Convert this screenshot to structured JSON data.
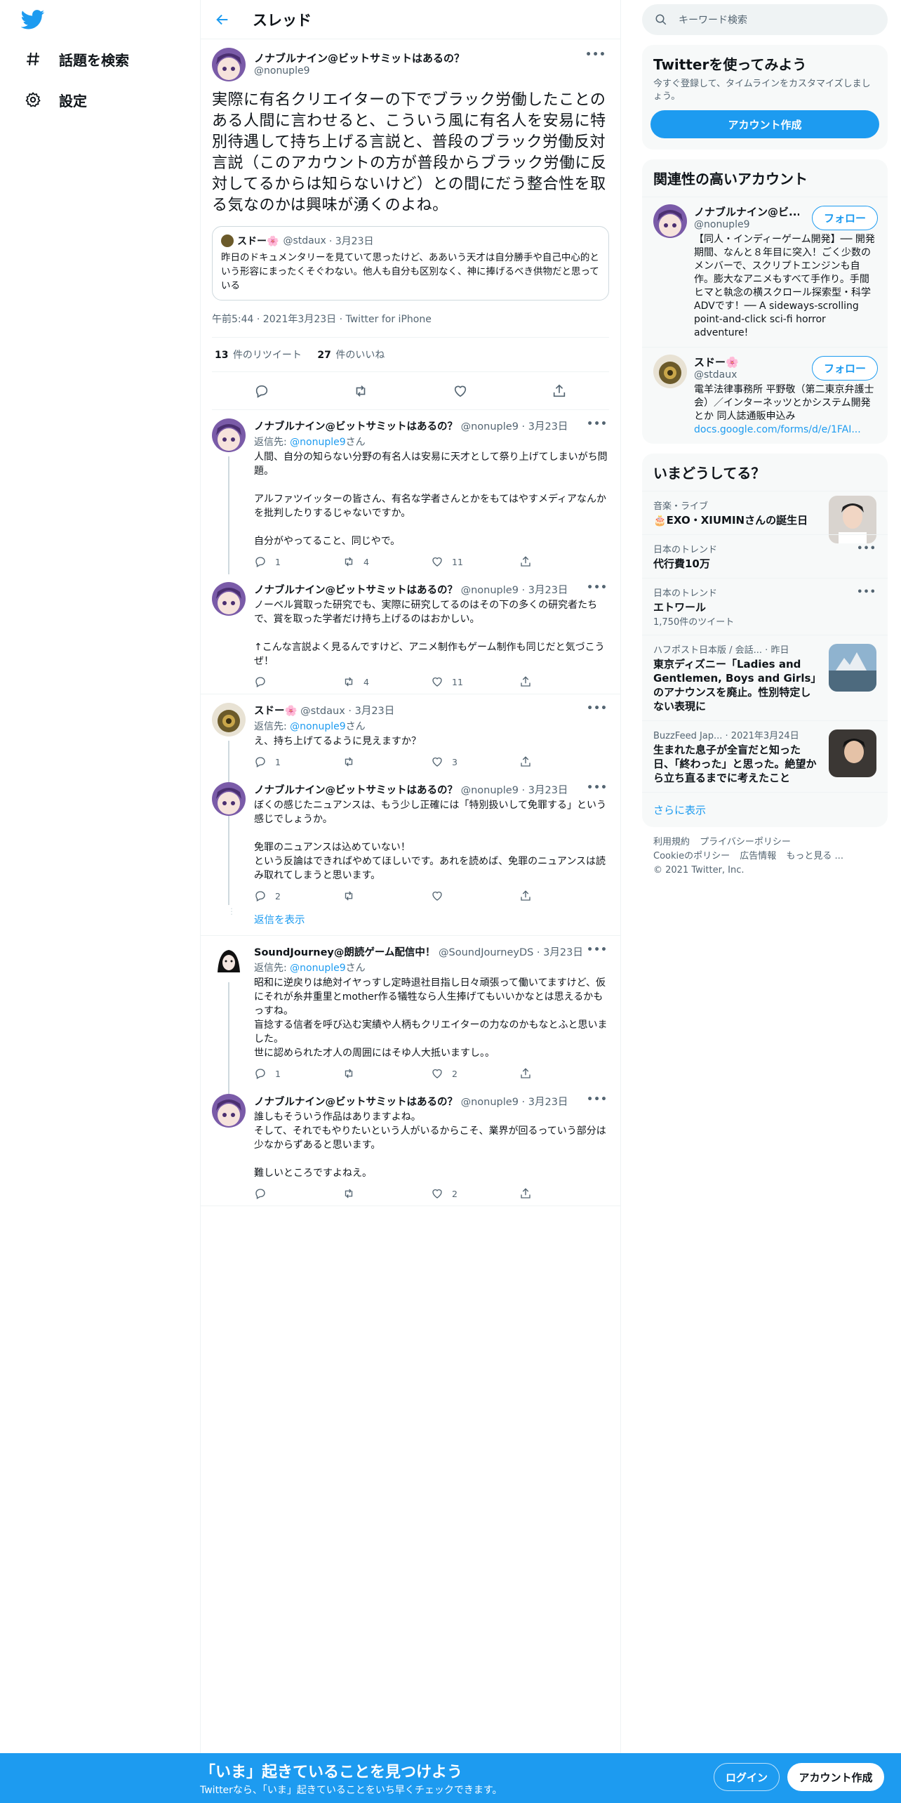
{
  "nav": {
    "explore_label": "話題を検索",
    "settings_label": "設定"
  },
  "header": {
    "title": "スレッド"
  },
  "main_tweet": {
    "name": "ノナブルナイン@ビットサミットはあるの？",
    "handle": "@nonuple9",
    "text": "実際に有名クリエイターの下でブラック労働したことのある人間に言わせると、こういう風に有名人を安易に特別待遇して持ち上げる言説と、普段のブラック労働反対言説（このアカウントの方が普段からブラック労働に反対してるからは知らないけど）との間にだう整合性を取る気なのかは興味が湧くのよね。",
    "quote": {
      "name": "スドー🌸",
      "handle": "@stdaux",
      "date": "· 3月23日",
      "text": "昨日のドキュメンタリーを見ていて思ったけど、ああいう天才は自分勝手や自己中心的という形容にまったくそぐわない。他人も自分も区別なく、神に捧げるべき供物だと思っている"
    },
    "meta": "午前5:44 · 2021年3月23日 · Twitter for iPhone",
    "retweets": "13",
    "retweets_label": "件のリツイート",
    "likes": "27",
    "likes_label": "件のいいね"
  },
  "replies": [
    {
      "name": "ノナブルナイン@ビットサミットはあるの？",
      "handle": "@nonuple9 · 3月23日",
      "replyto_prefix": "返信先: ",
      "replyto": "@nonuple9",
      "replyto_suffix": "さん",
      "text": "人間、自分の知らない分野の有名人は安易に天才として祭り上げてしまいがち問題。\n\nアルファツイッターの皆さん、有名な学者さんとかをもてはやすメディアなんかを批判したりするじゃないですか。\n\n自分がやってること、同じやで。",
      "reply_count": "1",
      "retweet_count": "4",
      "like_count": "11"
    },
    {
      "name": "ノナブルナイン@ビットサミットはあるの？",
      "handle": "@nonuple9 · 3月23日",
      "text": "ノーベル賞取った研究でも、実際に研究してるのはその下の多くの研究者たちで、賞を取った学者だけ持ち上げるのはおかしい。\n\n↑こんな言説よく見るんですけど、アニメ制作もゲーム制作も同じだと気づこうぜ！",
      "reply_count": "",
      "retweet_count": "4",
      "like_count": "11"
    },
    {
      "name": "スドー🌸",
      "handle": "@stdaux · 3月23日",
      "replyto_prefix": "返信先: ",
      "replyto": "@nonuple9",
      "replyto_suffix": "さん",
      "text": "え、持ち上げてるように見えますか？",
      "reply_count": "1",
      "retweet_count": "",
      "like_count": "3"
    },
    {
      "name": "ノナブルナイン@ビットサミットはあるの？",
      "handle": "@nonuple9 · 3月23日",
      "text": "ぼくの感じたニュアンスは、もう少し正確には「特別扱いして免罪する」という感じでしょうか。\n\n免罪のニュアンスは込めていない！\nという反論はできればやめてほしいです。あれを読めば、免罪のニュアンスは読み取れてしまうと思います。",
      "reply_count": "2",
      "retweet_count": "",
      "like_count": ""
    },
    {
      "name": "SoundJourney@朗読ゲーム配信中！",
      "handle": "@SoundJourneyDS · 3月23日",
      "replyto_prefix": "返信先: ",
      "replyto": "@nonuple9",
      "replyto_suffix": "さん",
      "text": "昭和に逆戻りは絶対イヤっすし定時退社目指し日々頑張って働いてますけど、仮にそれが糸井重里とmother作る犠牲なら人生捧げてもいいかなとは思えるかもっすね。\n盲捻する信者を呼び込む実績や人柄もクリエイターの力なのかもなとふと思いました。\n世に認められた才人の周囲にはそゆ人大抵いますし。。",
      "reply_count": "1",
      "retweet_count": "",
      "like_count": "2"
    },
    {
      "name": "ノナブルナイン@ビットサミットはあるの？",
      "handle": "@nonuple9 · 3月23日",
      "text": "誰しもそういう作品はありますよね。\nそして、それでもやりたいという人がいるからこそ、業界が回るっていう部分は少なからずあると思います。\n\n難しいところですよねえ。",
      "reply_count": "",
      "retweet_count": "",
      "like_count": "2"
    }
  ],
  "show_replies": "返信を表示",
  "sidebar": {
    "search_placeholder": "キーワード検索",
    "signup_title": "Twitterを使ってみよう",
    "signup_sub": "今すぐ登録して、タイムラインをカスタマイズしましょう。",
    "signup_button": "アカウント作成",
    "related_title": "関連性の高いアカウント",
    "follow_label": "フォロー",
    "accounts": [
      {
        "name": "ノナブルナイン@ビ...",
        "handle": "@nonuple9",
        "bio": "【同人・インディーゲーム開発】── 開発期間、なんと８年目に突入！ごく少数のメンバーで、スクリプトエンジンも自作。膨大なアニメもすべて手作り。手間ヒマと執念の横スクロール探索型・科学ADVです！── A sideways-scrolling point-and-click sci-fi horror adventure!",
        "link": ""
      },
      {
        "name": "スドー🌸",
        "handle": "@stdaux",
        "bio": "電羊法律事務所 平野敬（第二東京弁護士会）／インターネッツとかシステム開発とか 同人誌通販申込み ",
        "link": "docs.google.com/forms/d/e/1FAI..."
      }
    ],
    "trends_title": "いまどうしてる？",
    "trends": [
      {
        "context": "音楽・ライブ",
        "title": "🎂EXO・XIUMINさんの誕生日",
        "sub": ""
      },
      {
        "context": "日本のトレンド",
        "title": "代行費10万",
        "sub": ""
      },
      {
        "context": "日本のトレンド",
        "title": "エトワール",
        "sub": "1,750件のツイート"
      },
      {
        "context": "ハフポスト日本版 / 会話... · 昨日",
        "title": "東京ディズニー「Ladies and Gentlemen, Boys and Girls」のアナウンスを廃止。性別特定しない表現に",
        "sub": ""
      },
      {
        "context": "BuzzFeed Jap... · 2021年3月24日",
        "title": "生まれた息子が全盲だと知った日、「終わった」と思った。絶望から立ち直るまでに考えたこと",
        "sub": ""
      }
    ],
    "show_more": "さらに表示",
    "footer_links": [
      "利用規約",
      "プライバシーポリシー",
      "Cookieのポリシー",
      "広告情報",
      "もっと見る ..."
    ],
    "copyright": "© 2021 Twitter, Inc."
  },
  "bottom_bar": {
    "title": "「いま」起きていることを見つけよう",
    "subtitle": "Twitterなら、「いま」起きていることをいち早くチェックできます。",
    "login": "ログイン",
    "signup": "アカウント作成"
  },
  "colors": {
    "accent": "#1d9bf0",
    "text": "#0f1419",
    "muted": "#536471"
  }
}
